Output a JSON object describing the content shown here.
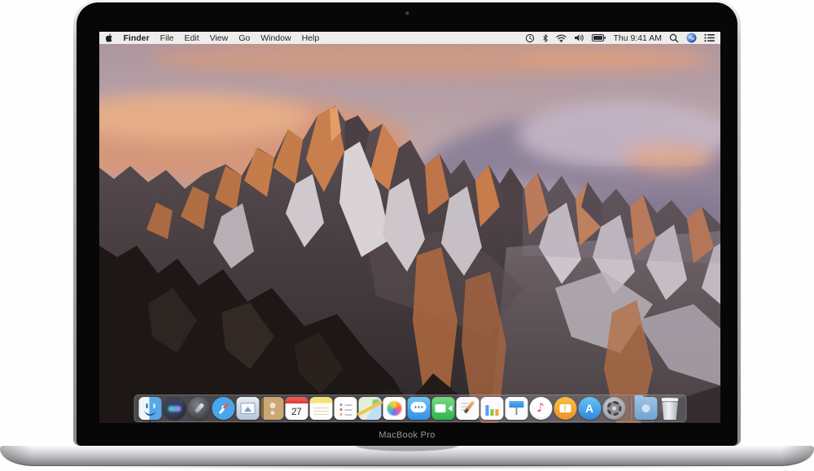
{
  "device": {
    "label": "MacBook Pro"
  },
  "menu_bar": {
    "left": {
      "apple_icon": "apple-logo",
      "items": [
        "Finder",
        "File",
        "Edit",
        "View",
        "Go",
        "Window",
        "Help"
      ]
    },
    "right": {
      "status_icons": [
        "clock-status-icon",
        "bluetooth-icon",
        "wifi-icon",
        "volume-icon",
        "battery-icon"
      ],
      "clock": "Thu 9:41 AM",
      "tool_icons": [
        "spotlight-search-icon",
        "siri-icon",
        "notification-center-icon"
      ]
    }
  },
  "dock": {
    "calendar_day": "27",
    "running_app": "Finder",
    "items": [
      {
        "id": "finder",
        "label": "Finder"
      },
      {
        "id": "siri",
        "label": "Siri"
      },
      {
        "id": "launchpad",
        "label": "Launchpad"
      },
      {
        "id": "safari",
        "label": "Safari"
      },
      {
        "id": "mail",
        "label": "Mail"
      },
      {
        "id": "contacts",
        "label": "Contacts"
      },
      {
        "id": "calendar",
        "label": "Calendar"
      },
      {
        "id": "notes",
        "label": "Notes"
      },
      {
        "id": "reminders",
        "label": "Reminders"
      },
      {
        "id": "maps",
        "label": "Maps"
      },
      {
        "id": "photos",
        "label": "Photos"
      },
      {
        "id": "messages",
        "label": "Messages"
      },
      {
        "id": "facetime",
        "label": "FaceTime"
      },
      {
        "id": "pages",
        "label": "Pages"
      },
      {
        "id": "numbers",
        "label": "Numbers"
      },
      {
        "id": "keynote",
        "label": "Keynote"
      },
      {
        "id": "itunes",
        "label": "iTunes"
      },
      {
        "id": "ibooks",
        "label": "iBooks"
      },
      {
        "id": "appstore",
        "label": "App Store"
      },
      {
        "id": "sysprefs",
        "label": "System Preferences"
      },
      {
        "id": "separator",
        "label": ""
      },
      {
        "id": "downloads",
        "label": "Downloads"
      },
      {
        "id": "trash",
        "label": "Trash"
      }
    ]
  },
  "wallpaper": {
    "description": "Sierra mountain peak at sunset"
  },
  "colors": {
    "menu_bar_bg": "#f7f5f4",
    "bezel_black": "#070708",
    "body_silver": "#c8c8cc",
    "dock_bg": "rgba(126,126,136,0.48)",
    "sky_pink": "#b8a2a6",
    "cloud_orange": "#d5977a",
    "cloud_purple": "#8b8099",
    "rock_dark": "#2e282b",
    "sunlit_orange": "#c67c49",
    "snow": "#d9d3d6"
  }
}
